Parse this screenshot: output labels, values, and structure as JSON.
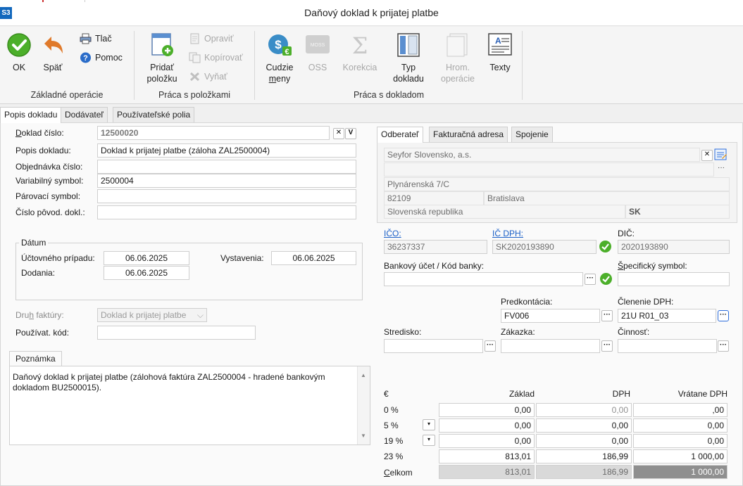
{
  "window": {
    "app_badge": "S3",
    "title": "Daňový doklad k prijatej platbe"
  },
  "ribbon": {
    "ok": "OK",
    "back": "Späť",
    "print": "Tlač",
    "help": "Pomoc",
    "group_basic": "Základné operácie",
    "add_item_1": "Pridať",
    "add_item_2": "položku",
    "edit": "Opraviť",
    "copy": "Kopírovať",
    "cut": "Vyňať",
    "group_items": "Práca s položkami",
    "currency_1": "Cudzie",
    "currency_2": "meny",
    "oss": "OSS",
    "oss_icon_text": "MOSS",
    "correction": "Korekcia",
    "doc_type_1": "Typ",
    "doc_type_2": "dokladu",
    "bulk_1": "Hrom.",
    "bulk_2": "operácie",
    "texts": "Texty",
    "group_doc": "Práca s dokladom"
  },
  "tabs": [
    "Popis dokladu",
    "Dodávateľ",
    "Používateľské polia"
  ],
  "left": {
    "doc_number_label": "Doklad číslo:",
    "doc_number": "12500020",
    "description_label": "Popis dokladu:",
    "description": "Doklad k prijatej platbe (záloha ZAL2500004)",
    "order_label": "Objednávka číslo:",
    "order": "",
    "vs_label": "Variabilný symbol:",
    "vs": "2500004",
    "pair_label": "Párovací symbol:",
    "pair": "",
    "orig_label": "Číslo pôvod. dokl.:",
    "orig": "",
    "date_group": "Dátum",
    "acc_date_label": "Účtovného prípadu:",
    "acc_date": "06.06.2025",
    "issue_label": "Vystavenia:",
    "issue_date": "06.06.2025",
    "delivery_label": "Dodania:",
    "delivery_date": "06.06.2025",
    "invoice_type_label": "Druh faktúry:",
    "invoice_type": "Doklad k prijatej platbe",
    "user_code_label": "Používat. kód:",
    "user_code": "",
    "note_tab": "Poznámka",
    "note": "Daňový doklad k prijatej platbe (zálohová faktúra ZAL2500004 - hradené bankovým dokladom BU2500015)."
  },
  "right_tabs": [
    "Odberateľ",
    "Fakturačná adresa",
    "Spojenie"
  ],
  "customer": {
    "name": "Seyfor Slovensko, a.s.",
    "name2": "",
    "street": "Plynárenská 7/C",
    "zip": "82109",
    "city": "Bratislava",
    "country": "Slovenská republika",
    "country_code": "SK",
    "ico_label": "IČO:",
    "ico": "36237337",
    "icdph_label": "IČ DPH:",
    "icdph": "SK2020193890",
    "dic_label": "DIČ:",
    "dic": "2020193890",
    "bank_label": "Bankový účet / Kód banky:",
    "bank": "",
    "spec_label": "Špecifický symbol:",
    "spec": "",
    "predkont_label": "Predkontácia:",
    "predkont": "FV006",
    "clen_label": "Členenie DPH:",
    "clen": "21U R01_03",
    "stredisko_label": "Stredisko:",
    "stredisko": "",
    "zakazka_label": "Zákazka:",
    "zakazka": "",
    "cinnost_label": "Činnosť:",
    "cinnost": ""
  },
  "vat_table": {
    "currency": "€",
    "col_base": "Základ",
    "col_vat": "DPH",
    "col_total": "Vrátane DPH",
    "rows": [
      {
        "rate": "0 %",
        "base": "0,00",
        "vat": "0,00",
        "total": ",00"
      },
      {
        "rate": "5 %",
        "base": "0,00",
        "vat": "0,00",
        "total": "0,00"
      },
      {
        "rate": "19 %",
        "base": "0,00",
        "vat": "0,00",
        "total": "0,00"
      },
      {
        "rate": "23 %",
        "base": "813,01",
        "vat": "186,99",
        "total": "1 000,00"
      }
    ],
    "sum_label": "Celkom",
    "sum_base": "813,01",
    "sum_vat": "186,99",
    "sum_total": "1 000,00"
  }
}
